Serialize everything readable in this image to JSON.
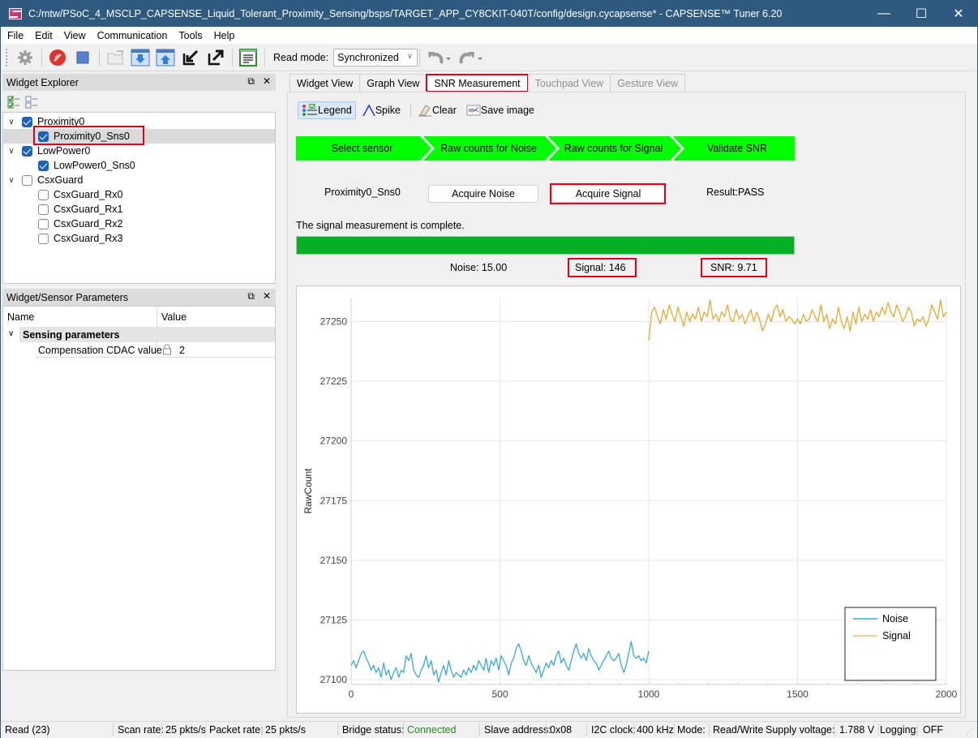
{
  "window": {
    "title": "C:/mtw/PSoC_4_MSCLP_CAPSENSE_Liquid_Tolerant_Proximity_Sensing/bsps/TARGET_APP_CY8CKIT-040T/config/design.cycapsense* - CAPSENSE™ Tuner 6.20",
    "controls": {
      "minimize": "—",
      "maximize": "☐",
      "close": "✕"
    }
  },
  "menu": [
    "File",
    "Edit",
    "View",
    "Communication",
    "Tools",
    "Help"
  ],
  "toolbar": {
    "icons": [
      "gear-icon",
      "disconnect-icon",
      "stop-icon",
      "open-folder-icon",
      "download-icon",
      "upload-icon",
      "import-icon",
      "export-icon",
      "log-icon"
    ],
    "read_mode_label": "Read mode:",
    "read_mode_value": "Synchronized",
    "undo_label": "Undo",
    "redo_label": "Redo"
  },
  "widget_explorer": {
    "title": "Widget Explorer",
    "tree": [
      {
        "label": "Proximity0",
        "checked": true,
        "level": 0,
        "expanded": true
      },
      {
        "label": "Proximity0_Sns0",
        "checked": true,
        "level": 1,
        "selected": true
      },
      {
        "label": "LowPower0",
        "checked": true,
        "level": 0,
        "expanded": true
      },
      {
        "label": "LowPower0_Sns0",
        "checked": true,
        "level": 1
      },
      {
        "label": "CsxGuard",
        "checked": false,
        "level": 0,
        "expanded": true
      },
      {
        "label": "CsxGuard_Rx0",
        "checked": false,
        "level": 1
      },
      {
        "label": "CsxGuard_Rx1",
        "checked": false,
        "level": 1
      },
      {
        "label": "CsxGuard_Rx2",
        "checked": false,
        "level": 1
      },
      {
        "label": "CsxGuard_Rx3",
        "checked": false,
        "level": 1
      }
    ]
  },
  "params_panel": {
    "title": "Widget/Sensor Parameters",
    "col_name": "Name",
    "col_value": "Value",
    "group": "Sensing parameters",
    "rows": [
      {
        "name": "Compensation CDAC value",
        "value": "2",
        "locked": true
      }
    ]
  },
  "tabs": [
    {
      "label": "Widget View",
      "state": "normal"
    },
    {
      "label": "Graph View",
      "state": "normal"
    },
    {
      "label": "SNR Measurement",
      "state": "active"
    },
    {
      "label": "Touchpad View",
      "state": "disabled"
    },
    {
      "label": "Gesture View",
      "state": "disabled"
    }
  ],
  "snr": {
    "tools": {
      "legend": "Legend",
      "spike": "Spike",
      "clear": "Clear",
      "save_image": "Save image"
    },
    "steps": [
      "Select sensor",
      "Raw counts for Noise",
      "Raw counts for Signal",
      "Validate SNR"
    ],
    "sensor": "Proximity0_Sns0",
    "acquire_noise": "Acquire Noise",
    "acquire_signal": "Acquire Signal",
    "result": "Result:PASS",
    "message": "The signal measurement is complete.",
    "progress": 1.0,
    "noise": "Noise:  15.00",
    "signal": "Signal:  146",
    "snr_value": "SNR:  9.71",
    "colors": {
      "step_green": "#00ff00",
      "progress_green": "#06b025",
      "highlight_red": "#e3001b"
    }
  },
  "chart_data": {
    "type": "line",
    "title": "",
    "xlabel": "",
    "ylabel": "RawCount",
    "xlim": [
      0,
      2000
    ],
    "ylim": [
      27098,
      27260
    ],
    "x_ticks": [
      0,
      500,
      1000,
      1500,
      2000
    ],
    "y_ticks": [
      27100,
      27125,
      27150,
      27175,
      27200,
      27225,
      27250
    ],
    "grid": true,
    "legend": "bottom-right",
    "series": [
      {
        "name": "Noise",
        "color": "#3aa8d8",
        "x_range": [
          0,
          1000
        ],
        "values": [
          27106,
          27108,
          27105,
          27108,
          27111,
          27112,
          27109,
          27107,
          27104,
          27106,
          27103,
          27105,
          27101,
          27107,
          27102,
          27104,
          27100,
          27103,
          27105,
          27101,
          27104,
          27103,
          27110,
          27108,
          27111,
          27104,
          27102,
          27101,
          27104,
          27106,
          27110,
          27105,
          27108,
          27102,
          27104,
          27099,
          27103,
          27106,
          27102,
          27108,
          27104,
          27101,
          27103,
          27102,
          27101,
          27104,
          27102,
          27105,
          27103,
          27106,
          27104,
          27108,
          27106,
          27104,
          27109,
          27103,
          27108,
          27106,
          27109,
          27104,
          27110,
          27108,
          27106,
          27102,
          27107,
          27109,
          27113,
          27115,
          27112,
          27108,
          27106,
          27110,
          27107,
          27105,
          27103,
          27106,
          27101,
          27104,
          27107,
          27105,
          27108,
          27106,
          27110,
          27112,
          27107,
          27109,
          27106,
          27104,
          27108,
          27112,
          27115,
          27111,
          27109,
          27111,
          27108,
          27113,
          27110,
          27108,
          27107,
          27104,
          27106,
          27108,
          27110,
          27112,
          27109,
          27108,
          27109,
          27111,
          27106,
          27103,
          27106,
          27111,
          27116,
          27110,
          27109,
          27110,
          27108,
          27109,
          27107,
          27112
        ]
      },
      {
        "name": "Signal",
        "color": "#e6a930",
        "x_range": [
          1000,
          2000
        ],
        "values": [
          27242,
          27254,
          27256,
          27252,
          27249,
          27255,
          27251,
          27257,
          27253,
          27250,
          27256,
          27252,
          27248,
          27254,
          27250,
          27253,
          27251,
          27256,
          27250,
          27254,
          27252,
          27259,
          27251,
          27253,
          27250,
          27254,
          27252,
          27257,
          27251,
          27250,
          27255,
          27251,
          27253,
          27249,
          27252,
          27255,
          27250,
          27254,
          27251,
          27246,
          27249,
          27253,
          27250,
          27255,
          27257,
          27252,
          27255,
          27250,
          27252,
          27251,
          27249,
          27251,
          27249,
          27253,
          27250,
          27251,
          27255,
          27252,
          27250,
          27257,
          27250,
          27253,
          27247,
          27251,
          27249,
          27256,
          27250,
          27247,
          27252,
          27246,
          27254,
          27249,
          27256,
          27250,
          27253,
          27251,
          27255,
          27250,
          27254,
          27252,
          27256,
          27253,
          27258,
          27254,
          27252,
          27257,
          27254,
          27250,
          27252,
          27256,
          27254,
          27248,
          27251,
          27250,
          27252,
          27248,
          27251,
          27257,
          27254,
          27251,
          27259,
          27252,
          27254
        ]
      }
    ]
  },
  "statusbar": {
    "read": "Read (23)",
    "scan_rate_label": "Scan rate:",
    "scan_rate": "25 pkts/s",
    "packet_rate_label": "Packet rate:",
    "packet_rate": "25 pkts/s",
    "bridge_label": "Bridge status:",
    "bridge": "Connected",
    "slave_label": "Slave address:",
    "slave": "0x08",
    "i2c_label": "I2C clock:",
    "i2c": "400 kHz",
    "mode_label": "Mode:",
    "mode": "Read/Write",
    "supply_label": "Supply voltage:",
    "supply": "1.788 V",
    "logging_label": "Logging:",
    "logging": "OFF",
    "connected_color": "#1e8e1e"
  }
}
